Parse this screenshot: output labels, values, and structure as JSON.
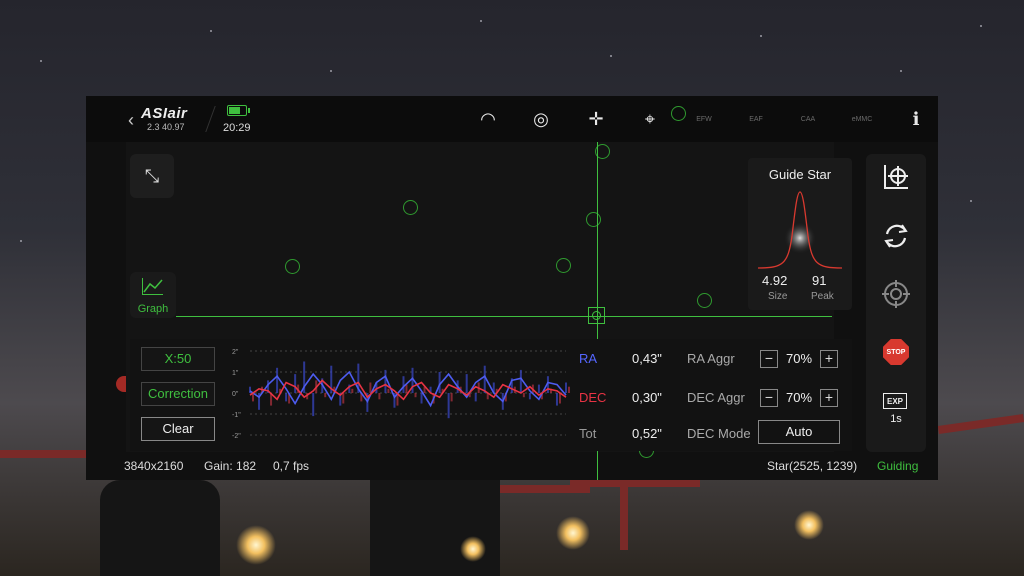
{
  "app": {
    "logo": "ASIair",
    "version": "2.3 40.97",
    "time": "20:29",
    "battery_level": 0.75
  },
  "toolbar": {
    "icons": [
      {
        "name": "wifi-icon",
        "glyph": "◠"
      },
      {
        "name": "link-icon",
        "glyph": "◎"
      },
      {
        "name": "crosshair-target-icon",
        "glyph": "✛"
      },
      {
        "name": "telescope-icon",
        "glyph": "⌖"
      },
      {
        "name": "efw-icon",
        "glyph": "⚙",
        "label": "EFW"
      },
      {
        "name": "eaf-icon",
        "glyph": "▭",
        "label": "EAF"
      },
      {
        "name": "caa-icon",
        "glyph": "☗",
        "label": "CAA"
      },
      {
        "name": "emmc-icon",
        "glyph": "▬",
        "label": "eMMC"
      },
      {
        "name": "info-icon",
        "glyph": "ℹ"
      }
    ]
  },
  "view": {
    "graph_label": "Graph"
  },
  "guide_star": {
    "title": "Guide Star",
    "size_value": "4.92",
    "size_label": "Size",
    "peak_value": "91",
    "peak_label": "Peak"
  },
  "controls": {
    "x_scale_label": "X:50",
    "correction_label": "Correction",
    "clear_label": "Clear",
    "y_ticks": [
      "2\"",
      "1\"",
      "0\"",
      "-1\"",
      "-2\""
    ],
    "ra_label": "RA",
    "ra_value": "0,43\"",
    "dec_label": "DEC",
    "dec_value": "0,30\"",
    "tot_label": "Tot",
    "tot_value": "0,52\"",
    "ra_aggr_label": "RA Aggr",
    "ra_aggr_value": "70%",
    "dec_aggr_label": "DEC Aggr",
    "dec_aggr_value": "70%",
    "dec_mode_label": "DEC Mode",
    "dec_mode_value": "Auto",
    "minus": "−",
    "plus": "+"
  },
  "side": {
    "exposure_icon_label": "EXP",
    "exposure_value": "1s"
  },
  "status": {
    "resolution": "3840x2160",
    "gain": "Gain: 182",
    "fps": "0,7 fps",
    "star": "Star(2525, 1239)",
    "state": "Guiding"
  },
  "colors": {
    "accent": "#3fbf3f",
    "ra": "#4d5cf0",
    "dec": "#e83344",
    "stop": "#d8392f"
  },
  "chart_data": {
    "type": "line",
    "ylim": [
      -2,
      2
    ],
    "series": [
      {
        "name": "RA",
        "values": [
          0.1,
          -0.2,
          0.4,
          0.8,
          0.2,
          -0.5,
          0.3,
          0.9,
          0.4,
          -0.3,
          0.6,
          1.0,
          0.2,
          -0.4,
          0.5,
          0.8,
          -0.2,
          0.3,
          0.7,
          0.1,
          -0.6,
          0.4,
          0.9,
          0.3,
          -0.2,
          0.5,
          0.8,
          0.0,
          -0.4,
          0.6,
          0.7,
          0.1,
          -0.3,
          0.5,
          0.4,
          -0.1
        ]
      },
      {
        "name": "DEC",
        "values": [
          -0.1,
          0.2,
          0.1,
          -0.3,
          0.5,
          0.3,
          -0.2,
          0.1,
          0.6,
          0.2,
          -0.1,
          0.3,
          0.5,
          -0.2,
          0.2,
          0.4,
          0.1,
          -0.3,
          0.3,
          0.5,
          0.0,
          -0.2,
          0.4,
          0.2,
          -0.1,
          0.3,
          0.1,
          -0.2,
          0.4,
          0.2,
          0.0,
          0.3,
          -0.1,
          0.2,
          0.1,
          -0.2
        ]
      }
    ],
    "correction_bars": {
      "ra": [
        0.3,
        -0.8,
        0.6,
        1.2,
        -0.4,
        0.9,
        1.5,
        -1.1,
        0.7,
        1.3,
        -0.6,
        0.4,
        1.4,
        -0.9,
        0.5,
        1.1,
        -0.7,
        0.8,
        1.2,
        -0.5,
        0.3,
        1.0,
        -1.2,
        0.6,
        0.9,
        -0.4,
        1.3,
        0.5,
        -0.8,
        0.7,
        1.1,
        -0.3,
        0.4,
        0.8,
        -0.6,
        0.5
      ],
      "dec": [
        -0.4,
        0.3,
        -0.6,
        0.2,
        -0.5,
        0.4,
        -0.3,
        0.6,
        -0.2,
        0.3,
        -0.5,
        0.2,
        -0.4,
        0.5,
        -0.3,
        0.2,
        -0.6,
        0.4,
        -0.2,
        0.3,
        -0.5,
        0.2,
        -0.4,
        0.3,
        -0.2,
        0.5,
        -0.3,
        0.2,
        -0.4,
        0.3,
        -0.2,
        0.4,
        -0.3,
        0.2,
        -0.5,
        0.3
      ]
    }
  }
}
